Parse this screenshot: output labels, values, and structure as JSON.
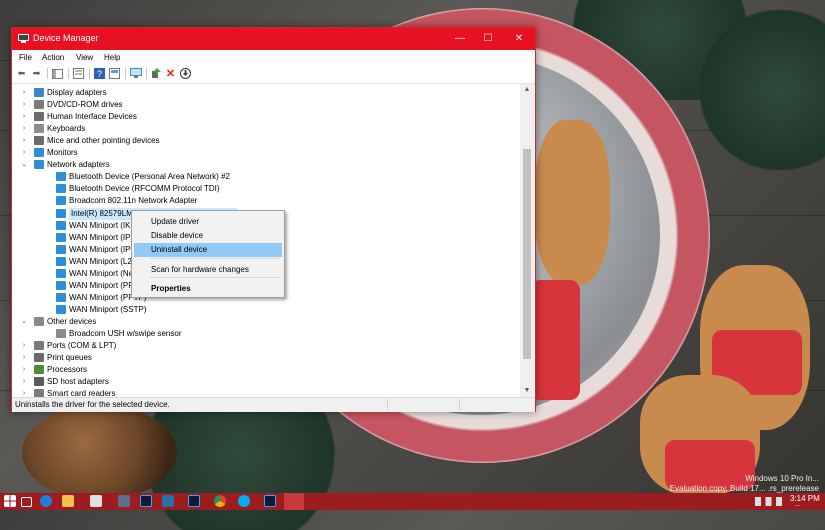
{
  "window": {
    "title": "Device Manager",
    "controls": {
      "minimize": "—",
      "maximize": "☐",
      "close": "✕"
    }
  },
  "menu": [
    "File",
    "Action",
    "View",
    "Help"
  ],
  "tree": [
    {
      "label": "Display adapters",
      "expander": "›",
      "level": 1,
      "icon": "display-adapter-icon",
      "color": "#3a86c8"
    },
    {
      "label": "DVD/CD-ROM drives",
      "expander": "›",
      "level": 1,
      "icon": "dvd-drive-icon",
      "color": "#7a7a7a"
    },
    {
      "label": "Human Interface Devices",
      "expander": "›",
      "level": 1,
      "icon": "hid-icon",
      "color": "#6b6b6b"
    },
    {
      "label": "Keyboards",
      "expander": "›",
      "level": 1,
      "icon": "keyboard-icon",
      "color": "#8c8c8c"
    },
    {
      "label": "Mice and other pointing devices",
      "expander": "›",
      "level": 1,
      "icon": "mouse-icon",
      "color": "#6a6a6a"
    },
    {
      "label": "Monitors",
      "expander": "›",
      "level": 1,
      "icon": "monitor-icon",
      "color": "#2f8fd6"
    },
    {
      "label": "Network adapters",
      "expander": "⌄",
      "level": 1,
      "icon": "network-adapter-icon",
      "color": "#2f8fd6"
    },
    {
      "label": "Bluetooth Device (Personal Area Network) #2",
      "expander": "",
      "level": 2,
      "icon": "network-card-icon",
      "color": "#2f8fd6"
    },
    {
      "label": "Bluetooth Device (RFCOMM Protocol TDI)",
      "expander": "",
      "level": 2,
      "icon": "network-card-icon",
      "color": "#2f8fd6"
    },
    {
      "label": "Broadcom 802.11n Network Adapter",
      "expander": "",
      "level": 2,
      "icon": "network-card-icon",
      "color": "#2f8fd6"
    },
    {
      "label": "Intel(R) 82579LM Gigabit Network Connection",
      "expander": "",
      "level": 2,
      "icon": "network-card-icon",
      "color": "#2f8fd6",
      "selected": true
    },
    {
      "label": "WAN Miniport (IKEv2)",
      "expander": "",
      "level": 2,
      "icon": "network-card-icon",
      "color": "#2f8fd6"
    },
    {
      "label": "WAN Miniport (IP)",
      "expander": "",
      "level": 2,
      "icon": "network-card-icon",
      "color": "#2f8fd6"
    },
    {
      "label": "WAN Miniport (IPv6)",
      "expander": "",
      "level": 2,
      "icon": "network-card-icon",
      "color": "#2f8fd6"
    },
    {
      "label": "WAN Miniport (L2TP)",
      "expander": "",
      "level": 2,
      "icon": "network-card-icon",
      "color": "#2f8fd6"
    },
    {
      "label": "WAN Miniport (Network Monitor)",
      "expander": "",
      "level": 2,
      "icon": "network-card-icon",
      "color": "#2f8fd6"
    },
    {
      "label": "WAN Miniport (PPPOE)",
      "expander": "",
      "level": 2,
      "icon": "network-card-icon",
      "color": "#2f8fd6"
    },
    {
      "label": "WAN Miniport (PPTP)",
      "expander": "",
      "level": 2,
      "icon": "network-card-icon",
      "color": "#2f8fd6"
    },
    {
      "label": "WAN Miniport (SSTP)",
      "expander": "",
      "level": 2,
      "icon": "network-card-icon",
      "color": "#2f8fd6"
    },
    {
      "label": "Other devices",
      "expander": "⌄",
      "level": 1,
      "icon": "other-devices-icon",
      "color": "#8a8a8a"
    },
    {
      "label": "Broadcom USH w/swipe sensor",
      "expander": "",
      "level": 2,
      "icon": "unknown-device-warning-icon",
      "color": "#8a8a8a"
    },
    {
      "label": "Ports (COM & LPT)",
      "expander": "›",
      "level": 1,
      "icon": "ports-icon",
      "color": "#7a7a7a"
    },
    {
      "label": "Print queues",
      "expander": "›",
      "level": 1,
      "icon": "printer-icon",
      "color": "#6a6a6a"
    },
    {
      "label": "Processors",
      "expander": "›",
      "level": 1,
      "icon": "processor-icon",
      "color": "#4d8a3a"
    },
    {
      "label": "SD host adapters",
      "expander": "›",
      "level": 1,
      "icon": "sd-adapter-icon",
      "color": "#5a5a5a"
    },
    {
      "label": "Smart card readers",
      "expander": "›",
      "level": 1,
      "icon": "smart-card-icon",
      "color": "#7a7a7a"
    }
  ],
  "context_menu": {
    "items": [
      {
        "label": "Update driver"
      },
      {
        "label": "Disable device"
      },
      {
        "label": "Uninstall device",
        "highlighted": true
      },
      {
        "label": "Scan for hardware changes"
      },
      {
        "label": "Properties",
        "bold": true
      }
    ]
  },
  "status": {
    "text": "Uninstalls the driver for the selected device."
  },
  "desktop": {
    "watermark_line1": "Windows 10 Pro In...",
    "watermark_line2": "Evaluation copy. Build 17... .rs_prerelease",
    "clock_time": "3:14 PM",
    "clock_date": "..."
  },
  "colors": {
    "accent": "#e81123",
    "taskbar": "#9c1c1f",
    "selection": "#cce8ff",
    "menu_highlight": "#91c9f7"
  }
}
